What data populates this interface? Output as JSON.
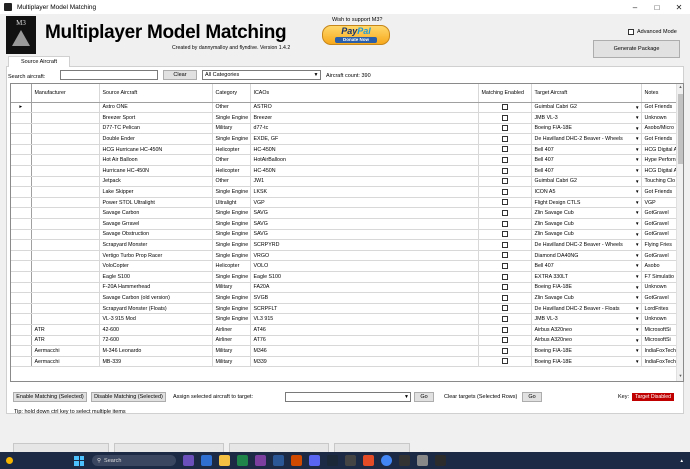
{
  "window": {
    "title": "Multiplayer Model Matching"
  },
  "header": {
    "logo_text": "M3",
    "app_title": "Multiplayer Model Matching",
    "credits": "Created by dannymalloy and flyndive. Version 1.4.2",
    "support_text": "Wish to support M3?",
    "paypal_brand_a": "Pay",
    "paypal_brand_b": "Pal",
    "paypal_donate": "Donate Now",
    "advanced_mode_label": "Advanced Mode",
    "advanced_mode_checked": false,
    "generate_label": "Generate Package"
  },
  "tabs": [
    {
      "label": "Source Aircraft",
      "active": true
    }
  ],
  "filters": {
    "search_label": "Search aircraft:",
    "search_value": "",
    "clear_label": "Clear",
    "category_value": "All Categories",
    "count_text": "Aircraft count: 390"
  },
  "table": {
    "columns": [
      "Manufacturer",
      "Source Aircraft",
      "Category",
      "ICAOs",
      "Matching Enabled",
      "Target Aircraft",
      "Notes"
    ],
    "rows": [
      {
        "mfr": "",
        "src": "Astro ONE",
        "cat": "Other",
        "icao": "ASTRO",
        "en": false,
        "tgt": "Guimbal Cabri G2",
        "notes": "Got Friends",
        "current": true
      },
      {
        "mfr": "",
        "src": "Breezer Sport",
        "cat": "Single Engine",
        "icao": "Breezer",
        "en": false,
        "tgt": "JMB VL-3",
        "notes": "Unknown"
      },
      {
        "mfr": "",
        "src": "D77-TC Pelican",
        "cat": "Military",
        "icao": "d77-tc",
        "en": false,
        "tgt": "Boeing F/A-18E",
        "notes": "Asobo/Micro"
      },
      {
        "mfr": "",
        "src": "Double Ender",
        "cat": "Single Engine",
        "icao": "EXDE, GF",
        "en": false,
        "tgt": "De Havilland DHC-2 Beaver - Wheels",
        "notes": "Got Friends"
      },
      {
        "mfr": "",
        "src": "HCG Hurricane HC-450N",
        "cat": "Helicopter",
        "icao": "HC-450N",
        "en": false,
        "tgt": "Bell 407",
        "notes": "HCG Digital A"
      },
      {
        "mfr": "",
        "src": "Hot Air Balloon",
        "cat": "Other",
        "icao": "HotAirBalloon",
        "en": false,
        "tgt": "Bell 407",
        "notes": "Hype Perforn"
      },
      {
        "mfr": "",
        "src": "Hurricane HC-450N",
        "cat": "Helicopter",
        "icao": "HC-450N",
        "en": false,
        "tgt": "Bell 407",
        "notes": "HCG Digital A"
      },
      {
        "mfr": "",
        "src": "Jetpack",
        "cat": "Other",
        "icao": "JW1",
        "en": false,
        "tgt": "Guimbal Cabri G2",
        "notes": "Touching Clo"
      },
      {
        "mfr": "",
        "src": "Lake Skipper",
        "cat": "Single Engine",
        "icao": "LKSK",
        "en": false,
        "tgt": "ICON A5",
        "notes": "Got Friends"
      },
      {
        "mfr": "",
        "src": "Power STOL Ultralight",
        "cat": "Ultralight",
        "icao": "VGP",
        "en": false,
        "tgt": "Flight Design CTLS",
        "notes": "VGP"
      },
      {
        "mfr": "",
        "src": "Savage Carbon",
        "cat": "Single Engine",
        "icao": "SAVG",
        "en": false,
        "tgt": "Zlin Savage Cub",
        "notes": "GotGravel"
      },
      {
        "mfr": "",
        "src": "Savage Grravel",
        "cat": "Single Engine",
        "icao": "SAVG",
        "en": false,
        "tgt": "Zlin Savage Cub",
        "notes": "GotGravel"
      },
      {
        "mfr": "",
        "src": "Savage Obstruction",
        "cat": "Single Engine",
        "icao": "SAVG",
        "en": false,
        "tgt": "Zlin Savage Cub",
        "notes": "GotGravel"
      },
      {
        "mfr": "",
        "src": "Scrapyard Monster",
        "cat": "Single Engine",
        "icao": "SCRPYRD",
        "en": false,
        "tgt": "De Havilland DHC-2 Beaver - Wheels",
        "notes": "Flying Fries"
      },
      {
        "mfr": "",
        "src": "Vertigo Turbo Prop Racer",
        "cat": "Single Engine",
        "icao": "VRGO",
        "en": false,
        "tgt": "Diamond DA40NG",
        "notes": "GotGravel"
      },
      {
        "mfr": "",
        "src": "VoloCopter",
        "cat": "Helicopter",
        "icao": "VOLO",
        "en": false,
        "tgt": "Bell 407",
        "notes": "Asobo"
      },
      {
        "mfr": "",
        "src": "Eagle S100",
        "cat": "Single Engine",
        "icao": "Eagle S100",
        "en": false,
        "tgt": "EXTRA 330LT",
        "notes": "F7 Simulatio"
      },
      {
        "mfr": "",
        "src": "F-20A Hammerhead",
        "cat": "Military",
        "icao": "FA20A",
        "en": false,
        "tgt": "Boeing F/A-18E",
        "notes": "Unknown"
      },
      {
        "mfr": "",
        "src": "Savage Carbon (old version)",
        "cat": "Single Engine",
        "icao": "SVGB",
        "en": false,
        "tgt": "Zlin Savage Cub",
        "notes": "GotGravel"
      },
      {
        "mfr": "",
        "src": "Scrapyard Monster (Floats)",
        "cat": "Single Engine",
        "icao": "SCRPFLT",
        "en": false,
        "tgt": "De Havilland DHC-2 Beaver - Floats",
        "notes": "LordFrites"
      },
      {
        "mfr": "",
        "src": "VL-3 915 Mod",
        "cat": "Single Engine",
        "icao": "VL3 915",
        "en": false,
        "tgt": "JMB VL-3",
        "notes": "Unknown"
      },
      {
        "mfr": "ATR",
        "src": "42-600",
        "cat": "Airliner",
        "icao": "AT46",
        "en": false,
        "tgt": "Airbus A320neo",
        "notes": "MicrosoftSi"
      },
      {
        "mfr": "ATR",
        "src": "72-600",
        "cat": "Airliner",
        "icao": "AT76",
        "en": false,
        "tgt": "Airbus A320neo",
        "notes": "MicrosoftSi"
      },
      {
        "mfr": "Aermacchi",
        "src": "M-346 Leonardo",
        "cat": "Military",
        "icao": "M346",
        "en": false,
        "tgt": "Boeing F/A-18E",
        "notes": "IndiaFoxTech"
      },
      {
        "mfr": "Aermacchi",
        "src": "MB-339",
        "cat": "Military",
        "icao": "M339",
        "en": false,
        "tgt": "Boeing F/A-18E",
        "notes": "IndiaFoxTech"
      }
    ]
  },
  "bottom": {
    "enable_label": "Enable Matching (Selected)",
    "disable_label": "Disable Matching (Selected)",
    "assign_label": "Assign selected aircraft to target:",
    "assign_value": "",
    "go_label": "Go",
    "clear_targets_label": "Clear targets (Selected Rows)",
    "go2_label": "Go",
    "key_label": "Key:",
    "key_badge": "Target Disabled",
    "key_badge_color": "#c00000"
  },
  "tip": "Tip: hold down ctrl key to select multiple items",
  "taskbar": {
    "search_placeholder": "Search"
  },
  "icons": [
    "minimize-icon",
    "maximize-icon",
    "close-icon",
    "row-pointer-icon",
    "dropdown-arrow-icon",
    "windows-start-icon",
    "search-icon",
    "weather-icon"
  ]
}
